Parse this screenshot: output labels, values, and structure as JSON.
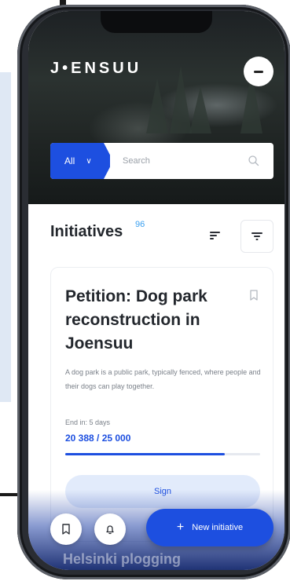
{
  "header": {
    "logo": "J•ENSUU",
    "menu_icon": "menu-icon"
  },
  "search": {
    "scope_label": "All",
    "scope_icon": "chevron-down-icon",
    "placeholder": "Search",
    "search_icon": "search-icon"
  },
  "list": {
    "title": "Initiatives",
    "count": "96",
    "sort_icon": "sort-icon",
    "filter_icon": "filter-icon"
  },
  "card": {
    "title": "Petition: Dog park reconstruction in Joensuu",
    "bookmark_icon": "bookmark-icon",
    "description": "A dog park is a public park, typically fenced, where people and their dogs can play together.",
    "end_label": "End in: 5 days",
    "signatures": "20 388 / 25 000",
    "progress": 0.82,
    "sign_label": "Sign"
  },
  "next_card": {
    "title": "Helsinki plogging"
  },
  "bottom_bar": {
    "bookmark_icon": "bookmark-icon",
    "bell_icon": "bell-icon",
    "new_label": "New initiative",
    "new_icon": "plus-icon"
  },
  "colors": {
    "accent": "#1d4fe0",
    "count_badge": "#3aa0f0",
    "sign_bg": "#e2ebfb"
  }
}
